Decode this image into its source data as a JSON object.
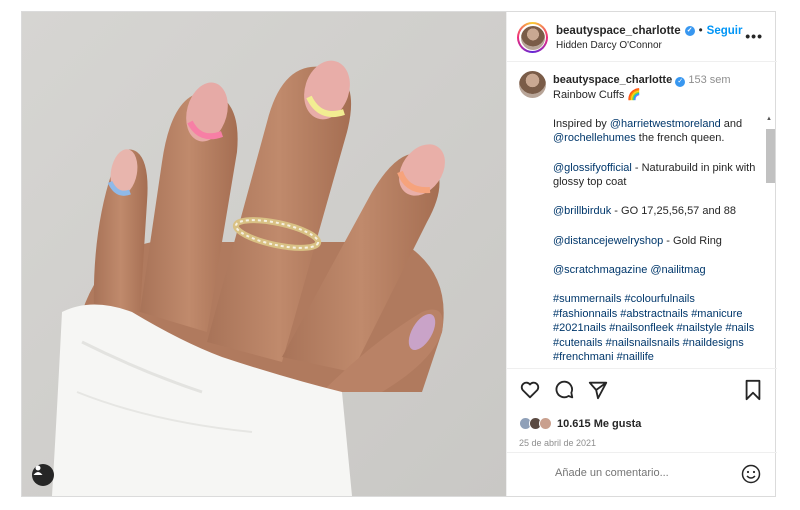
{
  "header": {
    "username": "beautyspace_charlotte",
    "follow_label": "Seguir",
    "subtitle": "Hidden Darcy O'Connor",
    "more_icon": "more-icon"
  },
  "caption": {
    "username": "beautyspace_charlotte",
    "time_ago": "153 sem",
    "title": "Rainbow Cuffs 🌈",
    "inspired_prefix": "Inspired by ",
    "mention_1": "@harrietwestmoreland",
    "and": " and",
    "mention_2": "@rochellehumes",
    "french_queen": " the french queen.",
    "glossify": "@glossifyofficial",
    "glossify_text": " - Naturabuild in pink with glossy top coat",
    "brill": "@brillbirduk",
    "brill_text": " - GO 17,25,56,57 and 88",
    "distance": "@distancejewelryshop",
    "distance_text": " - Gold Ring",
    "scratch": "@scratchmagazine",
    "nailitmag": "@nailitmag",
    "hashtags": "#summernails #colourfulnails #fashionnails #abstractnails #manicure #2021nails #nailsonfleek #nailstyle #nails #cutenails #nailsnailsnails #naildesigns #frenchmani #naillife"
  },
  "actions": {
    "likes": "10.615 Me gusta",
    "date": "25 de abril de 2021"
  },
  "comment": {
    "placeholder": "Añade un comentario..."
  },
  "colors": {
    "follow": "#0095f6",
    "link": "#00376b",
    "verified": "#3897f0"
  }
}
